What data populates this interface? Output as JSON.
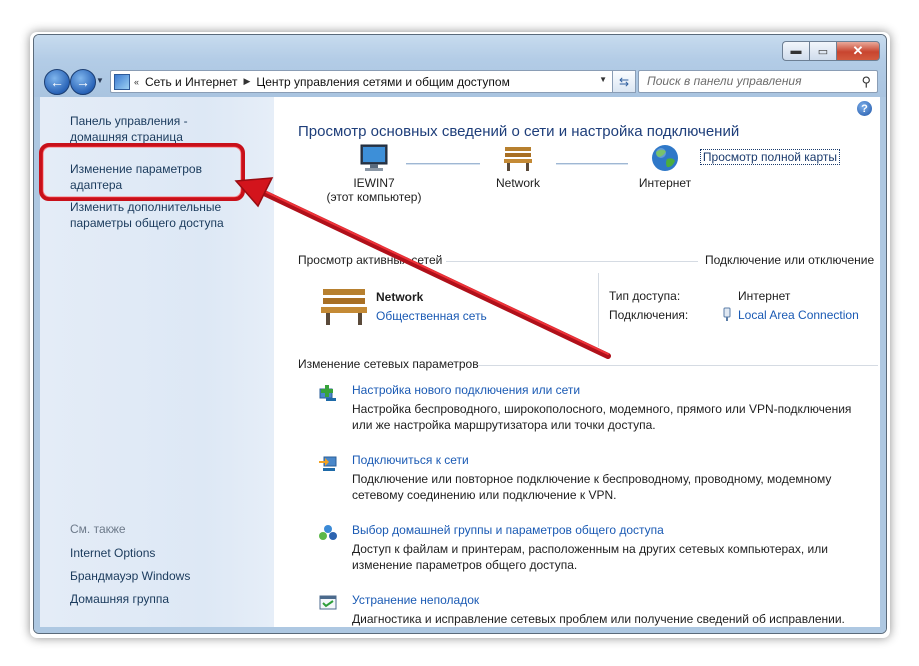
{
  "address": {
    "segments": [
      "Сеть и Интернет",
      "Центр управления сетями и общим доступом"
    ]
  },
  "search": {
    "placeholder": "Поиск в панели управления"
  },
  "sidebar": {
    "links": [
      {
        "label": "Панель управления -\nдомашняя страница"
      },
      {
        "label": "Изменение параметров\nадаптера"
      },
      {
        "label": "Изменить дополнительные\nпараметры общего доступа"
      }
    ],
    "see_also_label": "См. также",
    "see_also": [
      "Internet Options",
      "Брандмауэр Windows",
      "Домашняя группа"
    ]
  },
  "main": {
    "title": "Просмотр основных сведений о сети и настройка подключений",
    "full_map_link": "Просмотр полной карты",
    "map": {
      "computer": {
        "name": "IEWIN7",
        "sub": "(этот компьютер)"
      },
      "network": {
        "name": "Network"
      },
      "internet": {
        "name": "Интернет"
      }
    },
    "active_networks": {
      "header": "Просмотр активных сетей",
      "connect_link": "Подключение или отключение",
      "network_name": "Network",
      "network_type": "Общественная сеть",
      "access_type_label": "Тип доступа:",
      "access_type_value": "Интернет",
      "connections_label": "Подключения:",
      "connections_value": "Local Area Connection"
    },
    "change_settings": {
      "header": "Изменение сетевых параметров",
      "tasks": [
        {
          "title": "Настройка нового подключения или сети",
          "desc": "Настройка беспроводного, широкополосного, модемного, прямого или VPN-подключения или же настройка маршрутизатора или точки доступа."
        },
        {
          "title": "Подключиться к сети",
          "desc": "Подключение или повторное подключение к беспроводному, проводному, модемному сетевому соединению или подключение к VPN."
        },
        {
          "title": "Выбор домашней группы и параметров общего доступа",
          "desc": "Доступ к файлам и принтерам, расположенным на других сетевых компьютерах, или изменение параметров общего доступа."
        },
        {
          "title": "Устранение неполадок",
          "desc": "Диагностика и исправление сетевых проблем или получение сведений об исправлении."
        }
      ]
    }
  },
  "colors": {
    "annotation": "#e8151b",
    "link": "#1a5ab4",
    "title": "#1e3e7a"
  }
}
